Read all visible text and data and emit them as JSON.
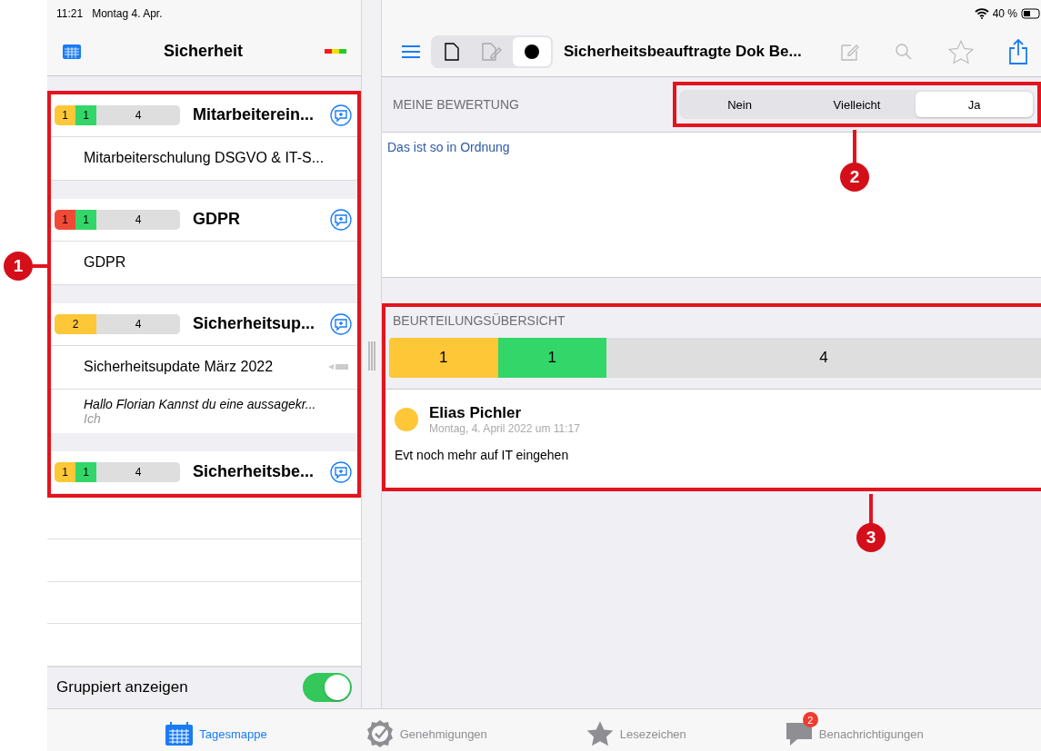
{
  "status_bar": {
    "time": "11:21",
    "date": "Montag 4. Apr.",
    "battery": "40 %"
  },
  "sidebar": {
    "title": "Sicherheit",
    "groups": [
      {
        "bar": [
          {
            "value": "1",
            "color": "#fdc737"
          },
          {
            "value": "1",
            "color": "#33d669"
          },
          {
            "value": "4",
            "color": "#dedede"
          }
        ],
        "title": "Mitarbeiterein...",
        "subtitle": "Mitarbeiterschulung DSGVO & IT-S...",
        "pencil": false
      },
      {
        "bar": [
          {
            "value": "1",
            "color": "#f04a37"
          },
          {
            "value": "1",
            "color": "#33d669"
          },
          {
            "value": "4",
            "color": "#dedede"
          }
        ],
        "title": "GDPR",
        "subtitle": "GDPR",
        "pencil": false
      },
      {
        "bar": [
          {
            "value": "2",
            "color": "#fdc737"
          },
          {
            "value": "4",
            "color": "#dedede"
          }
        ],
        "title": "Sicherheitsup...",
        "subtitle": "Sicherheitsupdate März 2022",
        "pencil": true,
        "message": {
          "text": "Hallo Florian Kannst du eine aussagekr...",
          "author": "Ich"
        }
      },
      {
        "bar": [
          {
            "value": "1",
            "color": "#fdc737"
          },
          {
            "value": "1",
            "color": "#33d669"
          },
          {
            "value": "4",
            "color": "#dedede"
          }
        ],
        "title": "Sicherheitsbe..."
      }
    ],
    "group_display": {
      "label": "Gruppiert anzeigen",
      "on": true
    }
  },
  "document": {
    "title": "Sicherheitsbeauftragte Dok Be...",
    "view_modes": [
      {
        "kind": "document",
        "selected": false
      },
      {
        "kind": "edit",
        "selected": false
      },
      {
        "kind": "dot",
        "selected": true
      }
    ],
    "my_rating": {
      "heading": "MEINE BEWERTUNG",
      "options": [
        {
          "label": "Nein",
          "selected": false
        },
        {
          "label": "Vielleicht",
          "selected": false
        },
        {
          "label": "Ja",
          "selected": true
        }
      ],
      "comment": "Das ist so in Ordnung"
    },
    "overview": {
      "heading": "BEURTEILUNGSÜBERSICHT",
      "bar": [
        {
          "value": "1",
          "color": "#fdc737"
        },
        {
          "value": "1",
          "color": "#33d669"
        },
        {
          "value": "4",
          "color": "#dedede"
        }
      ],
      "reviews": [
        {
          "name": "Elias Pichler",
          "date": "Montag, 4. April 2022 um 11:17",
          "comment": "Evt noch mehr auf IT eingehen",
          "color": "#fdc737"
        }
      ]
    }
  },
  "tab_bar": [
    {
      "kind": "calendar",
      "label": "Tagesmappe",
      "selected": true
    },
    {
      "kind": "approval",
      "label": "Genehmigungen",
      "selected": false
    },
    {
      "kind": "star",
      "label": "Lesezeichen",
      "selected": false
    },
    {
      "kind": "chat",
      "label": "Benachrichtigungen",
      "selected": false,
      "badge": "2"
    }
  ],
  "annotations": [
    {
      "number": "1"
    },
    {
      "number": "2"
    },
    {
      "number": "3"
    }
  ]
}
